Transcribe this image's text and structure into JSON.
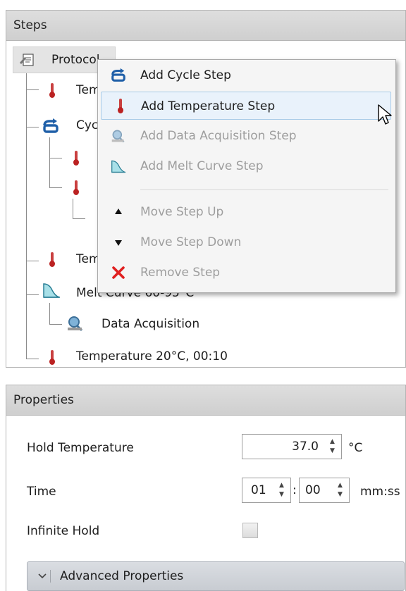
{
  "steps_panel": {
    "title": "Steps",
    "tree": {
      "protocol": "Protocol",
      "temp1": "Temperature",
      "cycle": "Cycle",
      "temp2": "Temperature",
      "melt_curve": "Melt Curve 60-95°C",
      "data_acquisition": "Data Acquisition",
      "last_temp": "Temperature 20°C, 00:10"
    }
  },
  "context_menu": {
    "items": [
      {
        "label": "Add Cycle Step",
        "icon": "cycle-icon",
        "enabled": true
      },
      {
        "label": "Add Temperature Step",
        "icon": "thermometer-icon",
        "enabled": true,
        "highlighted": true
      },
      {
        "label": "Add Data Acquisition Step",
        "icon": "data-acquisition-icon",
        "enabled": false
      },
      {
        "label": "Add Melt Curve Step",
        "icon": "melt-curve-icon",
        "enabled": false
      },
      {
        "label": "Move Step Up",
        "icon": "triangle-up-icon",
        "enabled": false
      },
      {
        "label": "Move Step Down",
        "icon": "triangle-down-icon",
        "enabled": false
      },
      {
        "label": "Remove Step",
        "icon": "red-x-icon",
        "enabled": false
      }
    ]
  },
  "properties_panel": {
    "title": "Properties",
    "hold_temperature_label": "Hold Temperature",
    "hold_temperature_value": "37.0",
    "hold_temperature_unit": "°C",
    "time_label": "Time",
    "time_minutes": "01",
    "time_separator": ":",
    "time_seconds": "00",
    "time_unit": "mm:ss",
    "infinite_hold_label": "Infinite Hold",
    "infinite_hold_checked": false,
    "advanced_label": "Advanced Properties"
  },
  "colors": {
    "thermometer": "#c0392b",
    "cycle_icon": "#1f5fa8",
    "remove_x": "#e02020",
    "menu_highlight": "#e9f2fb"
  }
}
